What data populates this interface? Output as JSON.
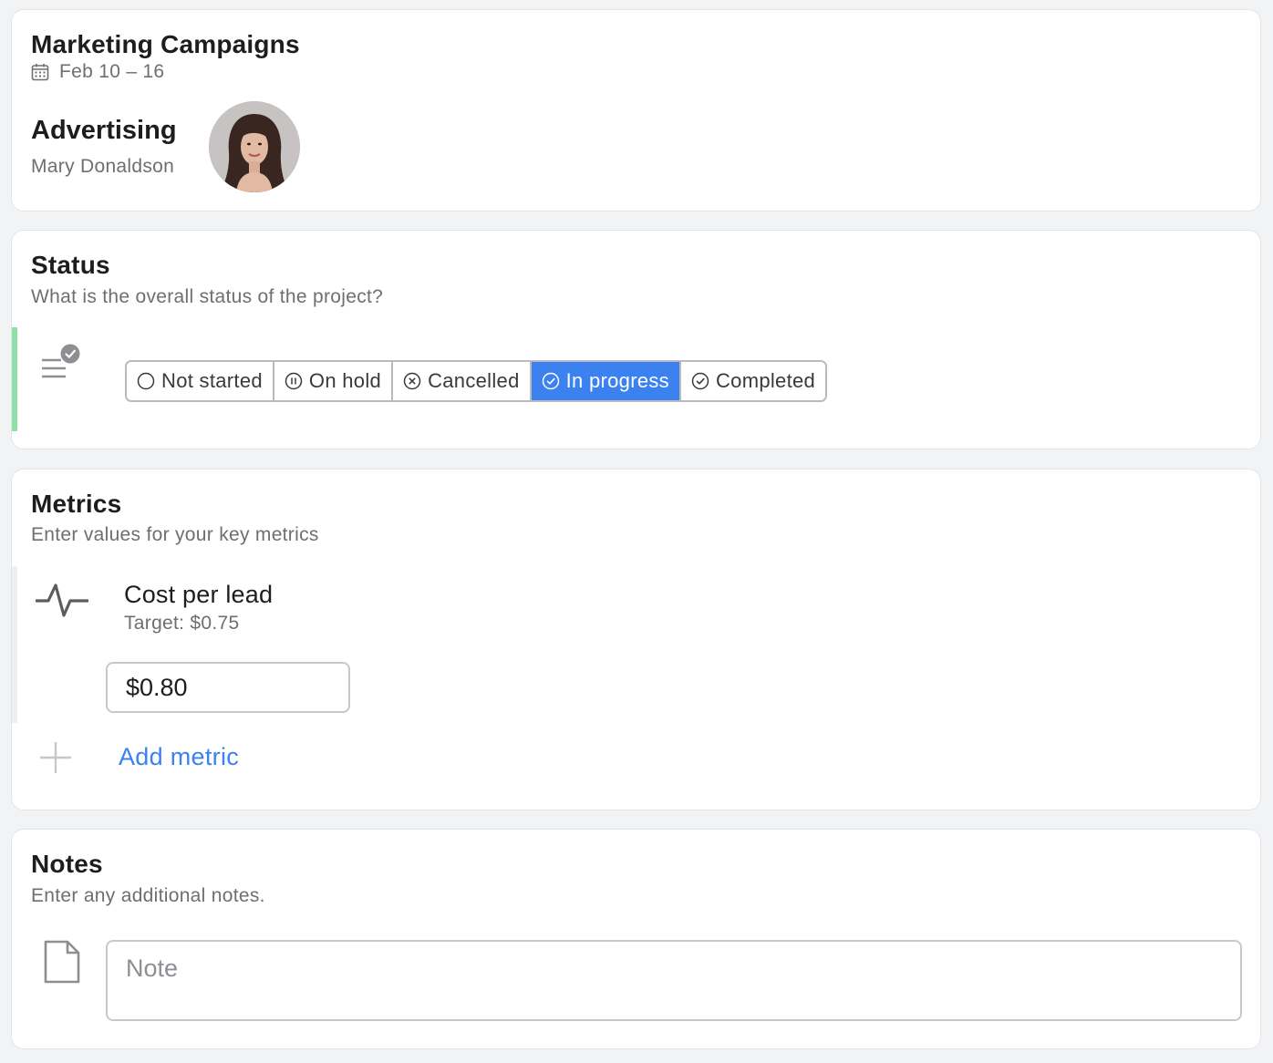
{
  "header": {
    "title": "Marketing Campaigns",
    "date_range": "Feb 10 – 16",
    "team": "Advertising",
    "owner": "Mary Donaldson",
    "date_icon": "calendar-icon"
  },
  "status": {
    "title": "Status",
    "description": "What is the overall status of the project?",
    "icon": "status-list-check-icon",
    "options": [
      {
        "label": "Not started",
        "icon": "circle-icon"
      },
      {
        "label": "On hold",
        "icon": "pause-circle-icon"
      },
      {
        "label": "Cancelled",
        "icon": "x-circle-icon"
      },
      {
        "label": "In progress",
        "icon": "check-circle-icon"
      },
      {
        "label": "Completed",
        "icon": "check-circle-icon"
      }
    ],
    "selected": "In progress",
    "accent_color": "#8fe0a4",
    "selected_color": "#3b82f0"
  },
  "metrics": {
    "title": "Metrics",
    "description": "Enter values for your key metrics",
    "items": [
      {
        "name": "Cost per lead",
        "target": "Target: $0.75",
        "value": "$0.80",
        "icon": "pulse-icon"
      }
    ],
    "add_label": "Add metric"
  },
  "notes": {
    "title": "Notes",
    "description": "Enter any additional notes.",
    "placeholder": "Note",
    "icon": "document-icon"
  }
}
